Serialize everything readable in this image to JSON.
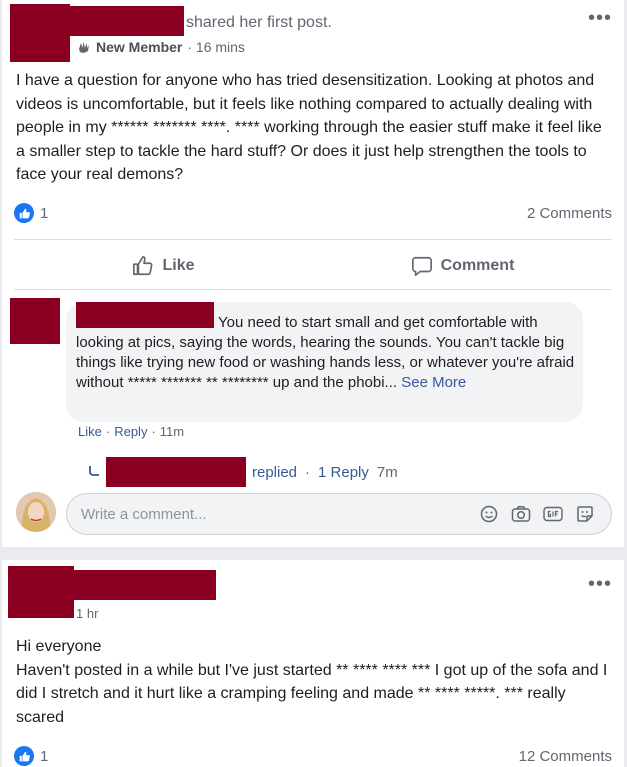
{
  "post1": {
    "shared_text": "shared her first post.",
    "badge": "New Member",
    "time": "· 16 mins",
    "body": "I have a question for anyone who has tried desensitization. Looking at photos and videos is uncomfortable, but it feels like nothing compared to actually dealing with people in my ****** ******* ****. **** working through the easier stuff make it feel like a smaller step to tackle the hard stuff? Or does it just help strengthen the tools to face your real demons?",
    "like_count": "1",
    "comments_count": "2 Comments",
    "like_label": "Like",
    "comment_label": "Comment",
    "comment": {
      "text": "You need to start small and get comfortable with looking at pics, saying the words, hearing the sounds. You can't tackle big things like trying new food or washing hands less, or whatever you're afraid without ***** ******* ** ******** up and the phobi...",
      "see_more": "See More",
      "like": "Like",
      "reply": "Reply",
      "time": "11m"
    },
    "reply": {
      "replied": "replied",
      "count": "1 Reply",
      "time": "7m"
    },
    "input_placeholder": "Write a comment..."
  },
  "post2": {
    "time": "1 hr",
    "body_line1": "Hi everyone",
    "body_rest": "Haven't posted in a while but I've just started ** **** **** *** I got up of the sofa and I did I stretch and it hurt like a cramping feeling and made ** **** *****. *** really scared",
    "like_count": "1",
    "comments_count": "12 Comments"
  },
  "colors": {
    "redaction": "#8b0021",
    "facebook_blue": "#1877f2",
    "link_blue": "#385898"
  },
  "icons": [
    "more-icon",
    "wave-badge-icon",
    "like-reaction-icon",
    "thumbs-up-icon",
    "comment-icon",
    "reply-arrow-icon",
    "emoji-icon",
    "camera-icon",
    "gif-icon",
    "sticker-icon"
  ]
}
